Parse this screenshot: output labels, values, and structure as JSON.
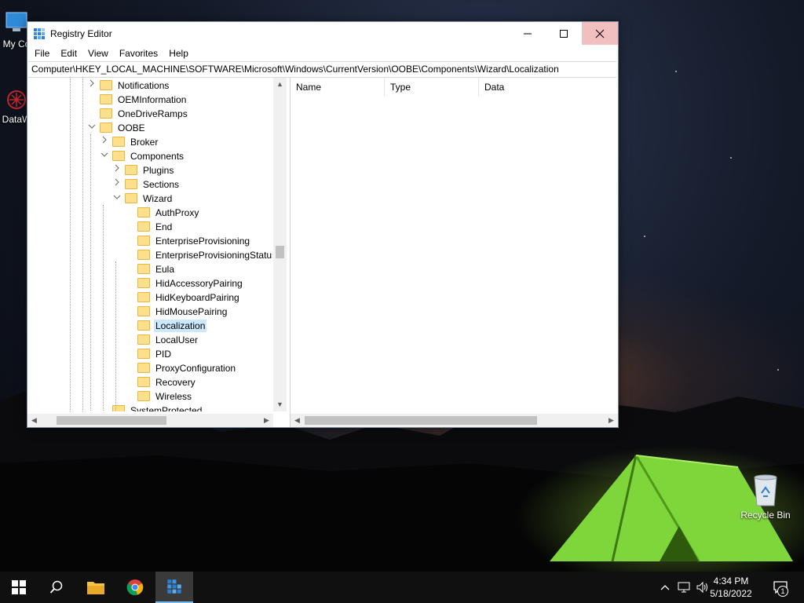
{
  "window": {
    "title": "Registry Editor",
    "minimize_glyph": "—",
    "maximize_glyph": "☐",
    "close_glyph": "✕"
  },
  "menu": [
    "File",
    "Edit",
    "View",
    "Favorites",
    "Help"
  ],
  "address": "Computer\\HKEY_LOCAL_MACHINE\\SOFTWARE\\Microsoft\\Windows\\CurrentVersion\\OOBE\\Components\\Wizard\\Localization",
  "tree": [
    {
      "label": "Notifications",
      "level": 0,
      "expander": "collapsed"
    },
    {
      "label": "OEMInformation",
      "level": 0,
      "expander": "none"
    },
    {
      "label": "OneDriveRamps",
      "level": 0,
      "expander": "none"
    },
    {
      "label": "OOBE",
      "level": 0,
      "expander": "expanded"
    },
    {
      "label": "Broker",
      "level": 1,
      "expander": "collapsed"
    },
    {
      "label": "Components",
      "level": 1,
      "expander": "expanded"
    },
    {
      "label": "Plugins",
      "level": 2,
      "expander": "collapsed"
    },
    {
      "label": "Sections",
      "level": 2,
      "expander": "collapsed"
    },
    {
      "label": "Wizard",
      "level": 2,
      "expander": "expanded"
    },
    {
      "label": "AuthProxy",
      "level": 3,
      "expander": "none"
    },
    {
      "label": "End",
      "level": 3,
      "expander": "none"
    },
    {
      "label": "EnterpriseProvisioning",
      "level": 3,
      "expander": "none"
    },
    {
      "label": "EnterpriseProvisioningStatus",
      "level": 3,
      "expander": "none"
    },
    {
      "label": "Eula",
      "level": 3,
      "expander": "none"
    },
    {
      "label": "HidAccessoryPairing",
      "level": 3,
      "expander": "none"
    },
    {
      "label": "HidKeyboardPairing",
      "level": 3,
      "expander": "none"
    },
    {
      "label": "HidMousePairing",
      "level": 3,
      "expander": "none"
    },
    {
      "label": "Localization",
      "level": 3,
      "expander": "none",
      "selected": true
    },
    {
      "label": "LocalUser",
      "level": 3,
      "expander": "none"
    },
    {
      "label": "PID",
      "level": 3,
      "expander": "none"
    },
    {
      "label": "ProxyConfiguration",
      "level": 3,
      "expander": "none"
    },
    {
      "label": "Recovery",
      "level": 3,
      "expander": "none"
    },
    {
      "label": "Wireless",
      "level": 3,
      "expander": "none"
    },
    {
      "label": "SystemProtected",
      "level": 1,
      "expander": "none"
    }
  ],
  "list_columns": [
    "Name",
    "Type",
    "Data"
  ],
  "desktop_icons": {
    "my_computer": "My Co",
    "datawizard": "DataW",
    "recycle_bin": "Recycle Bin"
  },
  "taskbar": {
    "time": "4:34 PM",
    "date": "5/18/2022",
    "notification_count": "1"
  },
  "colors": {
    "selection": "#cce8ff",
    "close_hover": "#f1bfc0",
    "folder": "#ffe08a",
    "taskbar": "#101010",
    "taskbar_active_underline": "#76b9ed"
  }
}
